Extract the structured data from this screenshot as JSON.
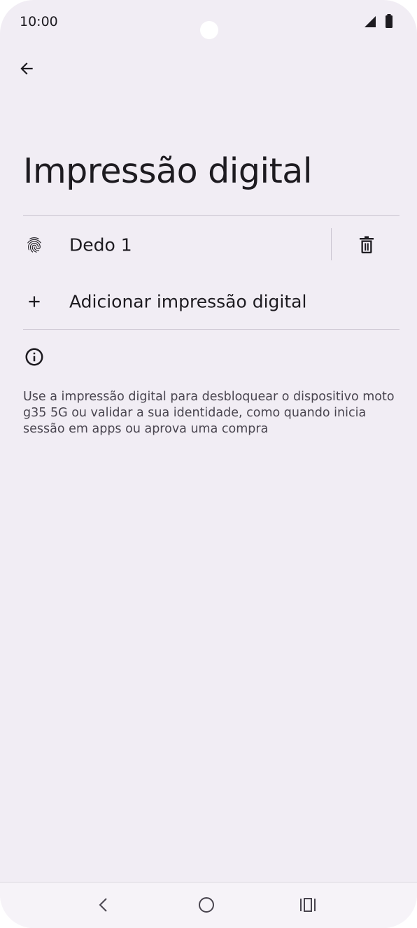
{
  "status_bar": {
    "time": "10:00",
    "icons": [
      "signal-icon",
      "battery-icon"
    ]
  },
  "header": {
    "back_icon": "arrow-left-icon"
  },
  "page": {
    "title": "Impressão digital"
  },
  "fingerprints": [
    {
      "label": "Dedo 1",
      "icon": "fingerprint-icon",
      "action_icon": "trash-icon"
    }
  ],
  "add_fingerprint": {
    "label": "Adicionar impressão digital",
    "icon": "plus-icon"
  },
  "info": {
    "icon": "info-icon",
    "text": "Use a impressão digital para desbloquear o dispositivo moto g35 5G ou validar a sua identidade, como quando inicia sessão em apps ou aprova uma compra"
  },
  "nav_bar": {
    "icons": [
      "back-icon",
      "home-icon",
      "recents-icon"
    ]
  },
  "colors": {
    "background": "#f1edf4",
    "text_primary": "#1d1b20",
    "text_secondary": "#49454f",
    "divider": "#cac4d0"
  }
}
